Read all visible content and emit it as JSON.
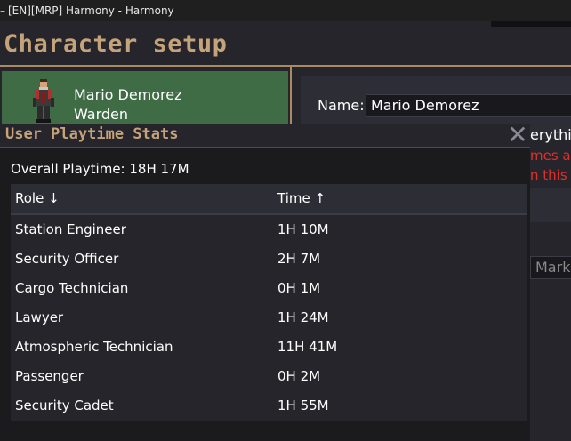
{
  "window": {
    "title": "[EN][MRP] Harmony - Harmony",
    "icon": "app-icon"
  },
  "page": {
    "title": "Character setup"
  },
  "character": {
    "name": "Mario Demorez",
    "job": "Warden"
  },
  "profile": {
    "name_label": "Name:",
    "name_value": "Mario Demorez"
  },
  "background_fragments": {
    "line1": "erythi",
    "line2": "mes a",
    "line3": "n this",
    "field": "Mark"
  },
  "dialog": {
    "title": "User Playtime Stats",
    "close_icon": "close-icon",
    "overall": "Overall Playtime: 18H 17M",
    "columns": {
      "role": "Role ↓",
      "time": "Time ↑"
    },
    "rows": [
      {
        "role": "Station Engineer",
        "time": "1H 10M"
      },
      {
        "role": "Security Officer",
        "time": "2H 7M"
      },
      {
        "role": "Cargo Technician",
        "time": "0H 1M"
      },
      {
        "role": "Lawyer",
        "time": "1H 24M"
      },
      {
        "role": "Atmospheric Technician",
        "time": "11H 41M"
      },
      {
        "role": "Passenger",
        "time": "0H 2M"
      },
      {
        "role": "Security Cadet",
        "time": "1H 55M"
      }
    ]
  },
  "colors": {
    "accent_title": "#c4a27a",
    "character_card": "#3f6b45",
    "warning_text": "#e0302a",
    "panel_bg": "#25252b"
  }
}
